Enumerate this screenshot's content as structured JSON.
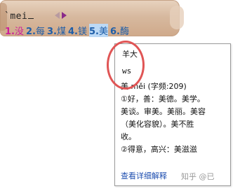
{
  "ime": {
    "composition": "`mei",
    "candidates": [
      {
        "num": "1.",
        "text": "没"
      },
      {
        "num": "2.",
        "text": "每"
      },
      {
        "num": "3.",
        "text": "煤"
      },
      {
        "num": "4.",
        "text": "镁"
      },
      {
        "num": "5.",
        "text": "美"
      },
      {
        "num": "6.",
        "text": "酶"
      }
    ],
    "active_index": 0,
    "highlight_index": 4
  },
  "tooltip": {
    "radicals": "羊大",
    "code": "ws",
    "headline": "美 měi (字频:209)",
    "lines": [
      "①好，善：美德。美学。",
      "美谈。审美。美丽。美容",
      "（美化容貌）。美不胜",
      "收。",
      "②得意，高兴：美滋滋"
    ],
    "link": "查看详细解释"
  },
  "watermark": "知乎 @已"
}
